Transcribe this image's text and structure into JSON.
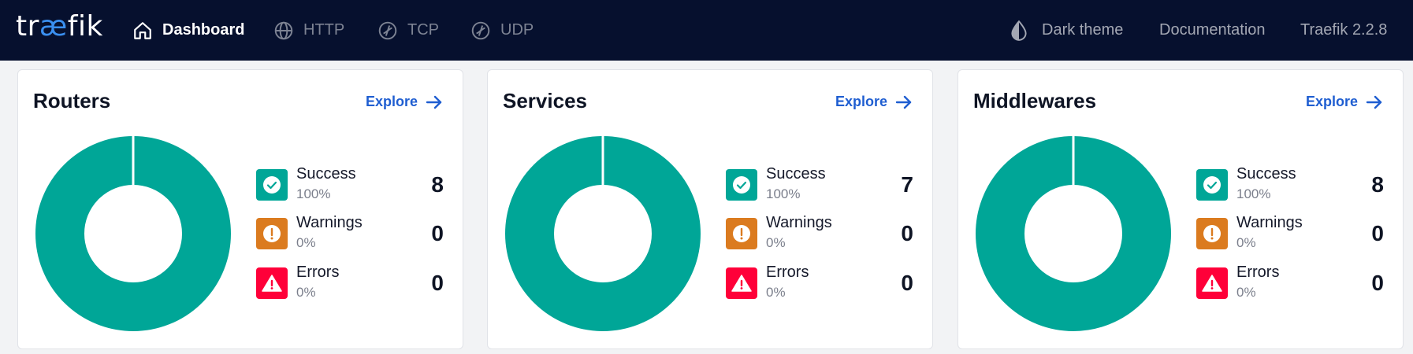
{
  "header": {
    "logo_prefix": "tr",
    "logo_ae": "æ",
    "logo_suffix": "fik",
    "nav": [
      {
        "label": "Dashboard",
        "icon": "home-icon",
        "active": true
      },
      {
        "label": "HTTP",
        "icon": "globe-icon",
        "active": false
      },
      {
        "label": "TCP",
        "icon": "tcp-icon",
        "active": false
      },
      {
        "label": "UDP",
        "icon": "udp-icon",
        "active": false
      }
    ],
    "right": {
      "theme_label": "Dark theme",
      "theme_icon": "theme-drop-icon",
      "docs_label": "Documentation",
      "version_label": "Traefik 2.2.8"
    }
  },
  "colors": {
    "header_bg": "#06102e",
    "success": "#00a697",
    "warning": "#db7b1f",
    "error": "#ff0039",
    "link": "#1f5ed1"
  },
  "cards": [
    {
      "title": "Routers",
      "explore": "Explore",
      "stats": [
        {
          "label": "Success",
          "pct": "100%",
          "count": "8",
          "icon": "check-icon"
        },
        {
          "label": "Warnings",
          "pct": "0%",
          "count": "0",
          "icon": "exclamation-icon"
        },
        {
          "label": "Errors",
          "pct": "0%",
          "count": "0",
          "icon": "alert-triangle-icon"
        }
      ]
    },
    {
      "title": "Services",
      "explore": "Explore",
      "stats": [
        {
          "label": "Success",
          "pct": "100%",
          "count": "7",
          "icon": "check-icon"
        },
        {
          "label": "Warnings",
          "pct": "0%",
          "count": "0",
          "icon": "exclamation-icon"
        },
        {
          "label": "Errors",
          "pct": "0%",
          "count": "0",
          "icon": "alert-triangle-icon"
        }
      ]
    },
    {
      "title": "Middlewares",
      "explore": "Explore",
      "stats": [
        {
          "label": "Success",
          "pct": "100%",
          "count": "8",
          "icon": "check-icon"
        },
        {
          "label": "Warnings",
          "pct": "0%",
          "count": "0",
          "icon": "exclamation-icon"
        },
        {
          "label": "Errors",
          "pct": "0%",
          "count": "0",
          "icon": "alert-triangle-icon"
        }
      ]
    }
  ]
}
